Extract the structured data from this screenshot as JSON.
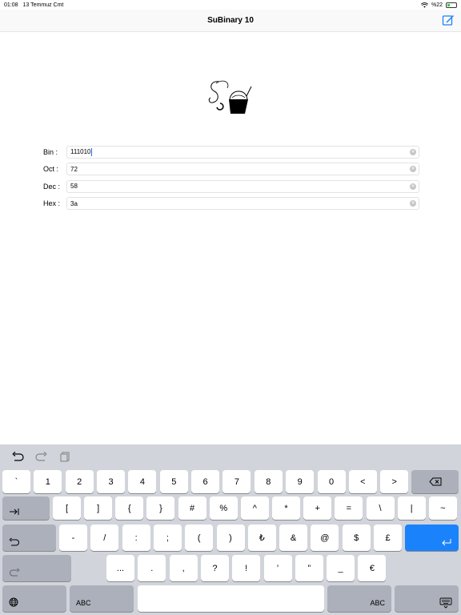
{
  "status_bar": {
    "time": "01:08",
    "date": "13 Temmuz Cmt",
    "battery": "%22"
  },
  "nav": {
    "title": "SuBinary 10",
    "compose_icon": "compose-icon"
  },
  "logo": {
    "icon": "subinary-logo"
  },
  "form": {
    "rows": [
      {
        "label": "Bin :",
        "value": "111010"
      },
      {
        "label": "Oct :",
        "value": "72"
      },
      {
        "label": "Dec :",
        "value": "58"
      },
      {
        "label": "Hex :",
        "value": "3a"
      }
    ]
  },
  "keyboard": {
    "toolbar": [
      "undo-icon",
      "redo-icon",
      "paste-icon"
    ],
    "row1": [
      "`",
      "1",
      "2",
      "3",
      "4",
      "5",
      "6",
      "7",
      "8",
      "9",
      "0",
      "<",
      ">"
    ],
    "row2": [
      "[",
      "]",
      "{",
      "}",
      "#",
      "%",
      "^",
      "*",
      "+",
      "=",
      "\\",
      "|",
      "~"
    ],
    "row3": [
      "-",
      "/",
      ":",
      ";",
      "(",
      ")",
      "₺",
      "&",
      "@",
      "$",
      "£"
    ],
    "row4": [
      "...",
      ".",
      ",",
      "?",
      "!",
      "’",
      "”",
      "_",
      "€"
    ],
    "abc_left": "ABC",
    "abc_right": "ABC"
  }
}
